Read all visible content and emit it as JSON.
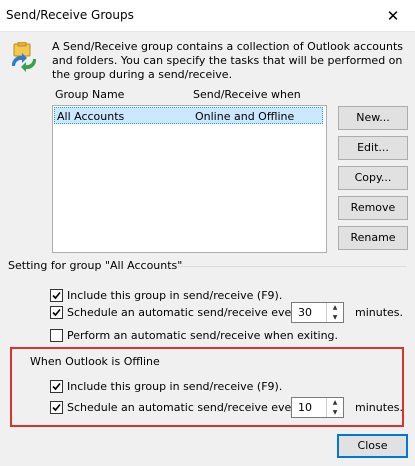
{
  "window": {
    "title": "Send/Receive Groups",
    "close_glyph": "✕",
    "icon": "send-receive-groups-icon"
  },
  "description": "A Send/Receive group contains a collection of Outlook accounts and folders. You can specify the tasks that will be performed on the group during a send/receive.",
  "groups_list": {
    "columns": [
      "Group Name",
      "Send/Receive when"
    ],
    "rows": [
      {
        "name": "All Accounts",
        "when": "Online and Offline",
        "selected": true
      }
    ]
  },
  "buttons": {
    "new": "New...",
    "edit": "Edit...",
    "copy": "Copy...",
    "remove": "Remove",
    "rename": "Rename",
    "close": "Close"
  },
  "setting_group_label": "Setting for group \"All Accounts\"",
  "online": {
    "include_label": "Include this group in send/receive (F9).",
    "include_checked": true,
    "schedule_label": "Schedule an automatic send/receive every",
    "schedule_checked": true,
    "schedule_value": "30",
    "minutes_label": "minutes.",
    "exiting_label": "Perform an automatic send/receive when exiting.",
    "exiting_checked": false
  },
  "offline": {
    "heading": "When Outlook is Offline",
    "include_label": "Include this group in send/receive (F9).",
    "include_checked": true,
    "schedule_label": "Schedule an automatic send/receive every",
    "schedule_checked": true,
    "schedule_value": "10",
    "minutes_label": "minutes."
  },
  "colors": {
    "highlight": "#d9342b",
    "selection": "#cce8ff",
    "accent": "#0078d7"
  }
}
